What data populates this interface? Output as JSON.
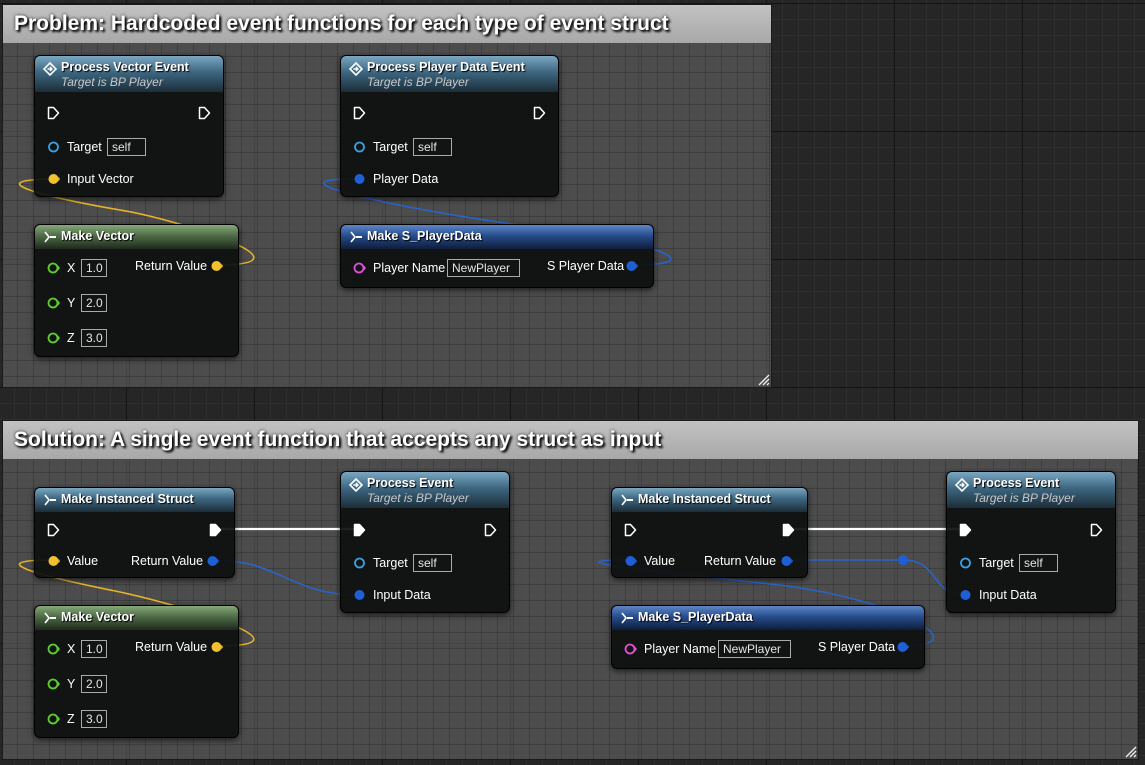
{
  "problem": {
    "title": "Problem: Hardcoded event functions for each type of event struct",
    "process_vector_event": {
      "title": "Process Vector Event",
      "subtitle": "Target is BP Player",
      "target_label": "Target",
      "target_value": "self",
      "input_label": "Input Vector"
    },
    "make_vector": {
      "title": "Make Vector",
      "return_label": "Return Value",
      "x_label": "X",
      "x_value": "1.0",
      "y_label": "Y",
      "y_value": "2.0",
      "z_label": "Z",
      "z_value": "3.0"
    },
    "process_player_data_event": {
      "title": "Process Player Data Event",
      "subtitle": "Target is BP Player",
      "target_label": "Target",
      "target_value": "self",
      "input_label": "Player Data"
    },
    "make_player_data": {
      "title": "Make S_PlayerData",
      "name_label": "Player Name",
      "name_value": "NewPlayer",
      "output_label": "S Player Data"
    }
  },
  "solution": {
    "title": "Solution: A single event function that accepts any struct as input",
    "make_instanced_struct_1": {
      "title": "Make Instanced Struct",
      "value_label": "Value",
      "return_label": "Return Value"
    },
    "make_vector": {
      "title": "Make Vector",
      "return_label": "Return Value",
      "x_label": "X",
      "x_value": "1.0",
      "y_label": "Y",
      "y_value": "2.0",
      "z_label": "Z",
      "z_value": "3.0"
    },
    "process_event_1": {
      "title": "Process Event",
      "subtitle": "Target is BP Player",
      "target_label": "Target",
      "target_value": "self",
      "input_label": "Input Data"
    },
    "make_instanced_struct_2": {
      "title": "Make Instanced Struct",
      "value_label": "Value",
      "return_label": "Return Value"
    },
    "make_player_data": {
      "title": "Make S_PlayerData",
      "name_label": "Player Name",
      "name_value": "NewPlayer",
      "output_label": "S Player Data"
    },
    "process_event_2": {
      "title": "Process Event",
      "subtitle": "Target is BP Player",
      "target_label": "Target",
      "target_value": "self",
      "input_label": "Input Data"
    }
  },
  "colors": {
    "vector_pin": "#f2c12e",
    "struct_pin": "#1f5fd6",
    "object_pin": "#3aa0e0",
    "float_pin": "#5ecf2e",
    "string_pin": "#e24ed6",
    "exec_pin": "#ffffff",
    "function_header": "#3d6680",
    "pure_header": "#4e6b46",
    "make_struct_header": "#264c8c"
  },
  "icons": {
    "function": "function-icon",
    "make": "make-struct-icon",
    "resize": "resize-grip-icon"
  }
}
